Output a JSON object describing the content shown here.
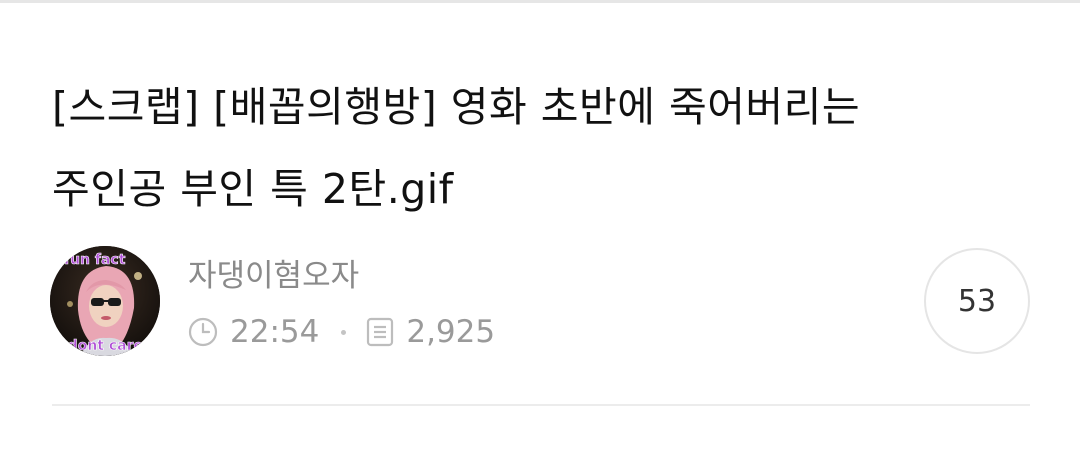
{
  "post": {
    "title_line1": "[스크랩] [배꼽의행방] 영화 초반에 죽어버리는",
    "title_line2": "주인공 부인 특 2탄.gif"
  },
  "author": {
    "name": "자댕이혐오자",
    "avatar_text_top": "fun fact",
    "avatar_text_bottom": "i dont care"
  },
  "meta": {
    "time": "22:54",
    "views": "2,925",
    "time_icon": "clock-icon",
    "views_icon": "document-icon"
  },
  "comments": {
    "count": "53"
  },
  "colors": {
    "title": "#111111",
    "meta_text": "#9a9a9a",
    "avatar_caption": "#b04fd6"
  }
}
